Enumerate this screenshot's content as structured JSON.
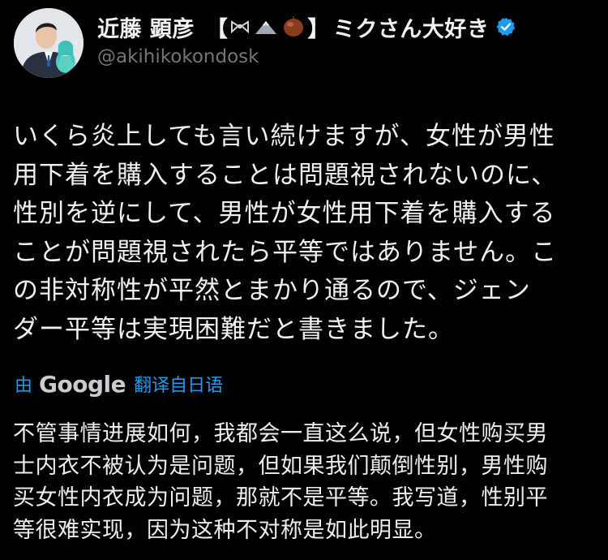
{
  "author": {
    "name": "近藤 顕彦",
    "name_badge": "【",
    "name_badge_close": "】",
    "name_suffix": "ミクさん大好き",
    "handle": "@akihikokondosk",
    "verified": true,
    "icons": [
      "bowtie-icon",
      "mountain-icon",
      "chestnut-icon"
    ]
  },
  "tweet": {
    "lines": [
      "いくら炎上しても言い続けますが、女性が男性",
      "用下着を購入することは問題視されないのに、",
      "性別を逆にして、男性が女性用下着を購入する",
      "ことが問題視されたら平等ではありません。こ",
      "の非対称性が平然とまかり通るので、ジェン",
      "ダー平等は実現困難だと書きました。"
    ]
  },
  "translation": {
    "by_label": "由",
    "provider": "Google",
    "from_label": "翻译自日语",
    "lines": [
      "不管事情进展如何，我都会一直这么说，但女性购买男",
      "士内衣不被认为是问题，但如果我们颠倒性别，男性购",
      "买女性内衣成为问题，那就不是平等。我写道，性别平",
      "等很难实现，因为这种不对称是如此明显。"
    ]
  },
  "colors": {
    "background": "#000000",
    "text": "#e7e9ea",
    "secondary": "#71767b",
    "accent": "#1d9bf0"
  }
}
